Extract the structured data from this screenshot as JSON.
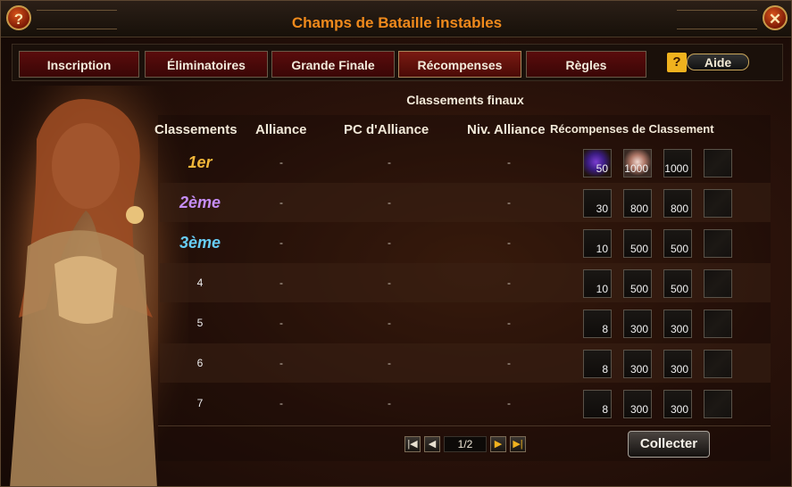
{
  "window": {
    "title": "Champs de Bataille instables",
    "help_symbol": "?",
    "close_symbol": "✕"
  },
  "tabs": [
    {
      "label": "Inscription",
      "active": false
    },
    {
      "label": "Éliminatoires",
      "active": false
    },
    {
      "label": "Grande Finale",
      "active": false
    },
    {
      "label": "Récompenses",
      "active": true
    },
    {
      "label": "Règles",
      "active": false
    }
  ],
  "aide": {
    "icon_text": "?",
    "label": "Aide"
  },
  "section_title": "Classements finaux",
  "columns": {
    "rank": "Classements",
    "alliance": "Alliance",
    "pc": "PC d'Alliance",
    "level": "Niv. Alliance",
    "rewards": "Récompenses de Classement"
  },
  "rows": [
    {
      "rank": "1er",
      "alliance": "-",
      "pc": "-",
      "level": "-",
      "rewards": [
        "50",
        "1000",
        "1000",
        ""
      ]
    },
    {
      "rank": "2ème",
      "alliance": "-",
      "pc": "-",
      "level": "-",
      "rewards": [
        "30",
        "800",
        "800",
        ""
      ]
    },
    {
      "rank": "3ème",
      "alliance": "-",
      "pc": "-",
      "level": "-",
      "rewards": [
        "10",
        "500",
        "500",
        ""
      ]
    },
    {
      "rank": "4",
      "alliance": "-",
      "pc": "-",
      "level": "-",
      "rewards": [
        "10",
        "500",
        "500",
        ""
      ]
    },
    {
      "rank": "5",
      "alliance": "-",
      "pc": "-",
      "level": "-",
      "rewards": [
        "8",
        "300",
        "300",
        ""
      ]
    },
    {
      "rank": "6",
      "alliance": "-",
      "pc": "-",
      "level": "-",
      "rewards": [
        "8",
        "300",
        "300",
        ""
      ]
    },
    {
      "rank": "7",
      "alliance": "-",
      "pc": "-",
      "level": "-",
      "rewards": [
        "8",
        "300",
        "300",
        ""
      ]
    }
  ],
  "pagination": {
    "page": "1/2",
    "first": "|◀",
    "prev": "◀",
    "next": "▶",
    "last": "▶|"
  },
  "collect_label": "Collecter",
  "colors": {
    "title": "#f08a1c",
    "tab_bg": "#5a0c0c",
    "rank1": "#f2b73a",
    "rank2": "#c58df5",
    "rank3": "#67cdf5"
  }
}
